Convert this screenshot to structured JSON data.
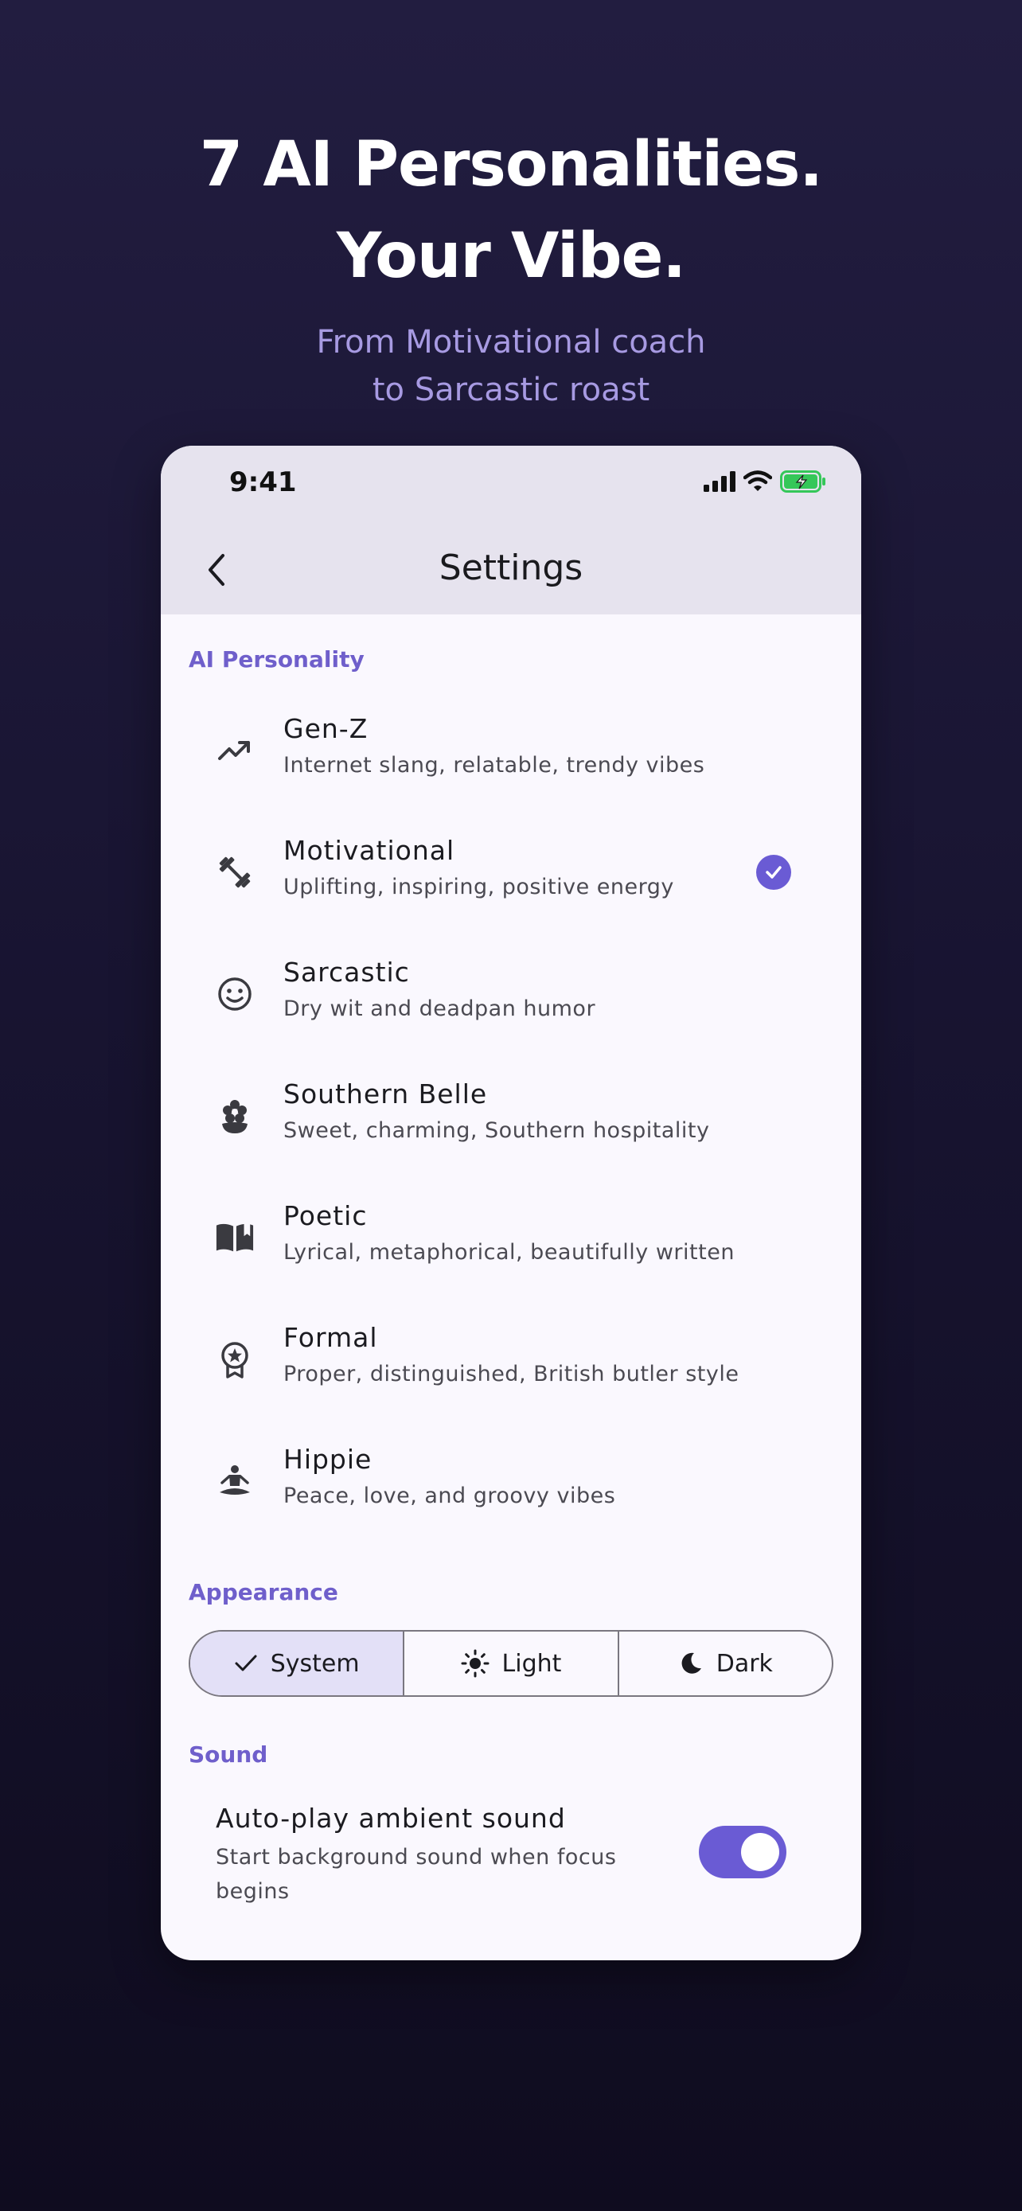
{
  "hero": {
    "title_line1": "7 AI Personalities.",
    "title_line2": "Your Vibe.",
    "subtitle_line1": "From Motivational coach",
    "subtitle_line2": "to Sarcastic roast"
  },
  "status_bar": {
    "time": "9:41"
  },
  "nav": {
    "title": "Settings",
    "back_icon": "chevron-left-icon"
  },
  "sections": {
    "personality": "AI Personality",
    "appearance": "Appearance",
    "sound": "Sound"
  },
  "personalities": [
    {
      "name": "Gen-Z",
      "desc": "Internet slang, relatable, trendy vibes",
      "icon": "trending-up-icon",
      "selected": false
    },
    {
      "name": "Motivational",
      "desc": "Uplifting, inspiring, positive energy",
      "icon": "dumbbell-icon",
      "selected": true
    },
    {
      "name": "Sarcastic",
      "desc": "Dry wit and deadpan humor",
      "icon": "smiley-icon",
      "selected": false
    },
    {
      "name": "Southern Belle",
      "desc": "Sweet, charming, Southern hospitality",
      "icon": "flower-icon",
      "selected": false
    },
    {
      "name": "Poetic",
      "desc": "Lyrical, metaphorical, beautifully written",
      "icon": "book-icon",
      "selected": false
    },
    {
      "name": "Formal",
      "desc": "Proper, distinguished, British butler style",
      "icon": "award-icon",
      "selected": false
    },
    {
      "name": "Hippie",
      "desc": "Peace, love, and groovy vibes",
      "icon": "meditation-icon",
      "selected": false
    }
  ],
  "appearance": {
    "options": [
      "System",
      "Light",
      "Dark"
    ],
    "selected": "System"
  },
  "sound": {
    "autoplay_title": "Auto-play ambient sound",
    "autoplay_desc": "Start background sound when focus begins",
    "autoplay_enabled": true
  },
  "colors": {
    "accent": "#6a5bd4",
    "section_label": "#6f5fcb",
    "subtitle": "#a79ae2",
    "battery": "#35c759"
  }
}
